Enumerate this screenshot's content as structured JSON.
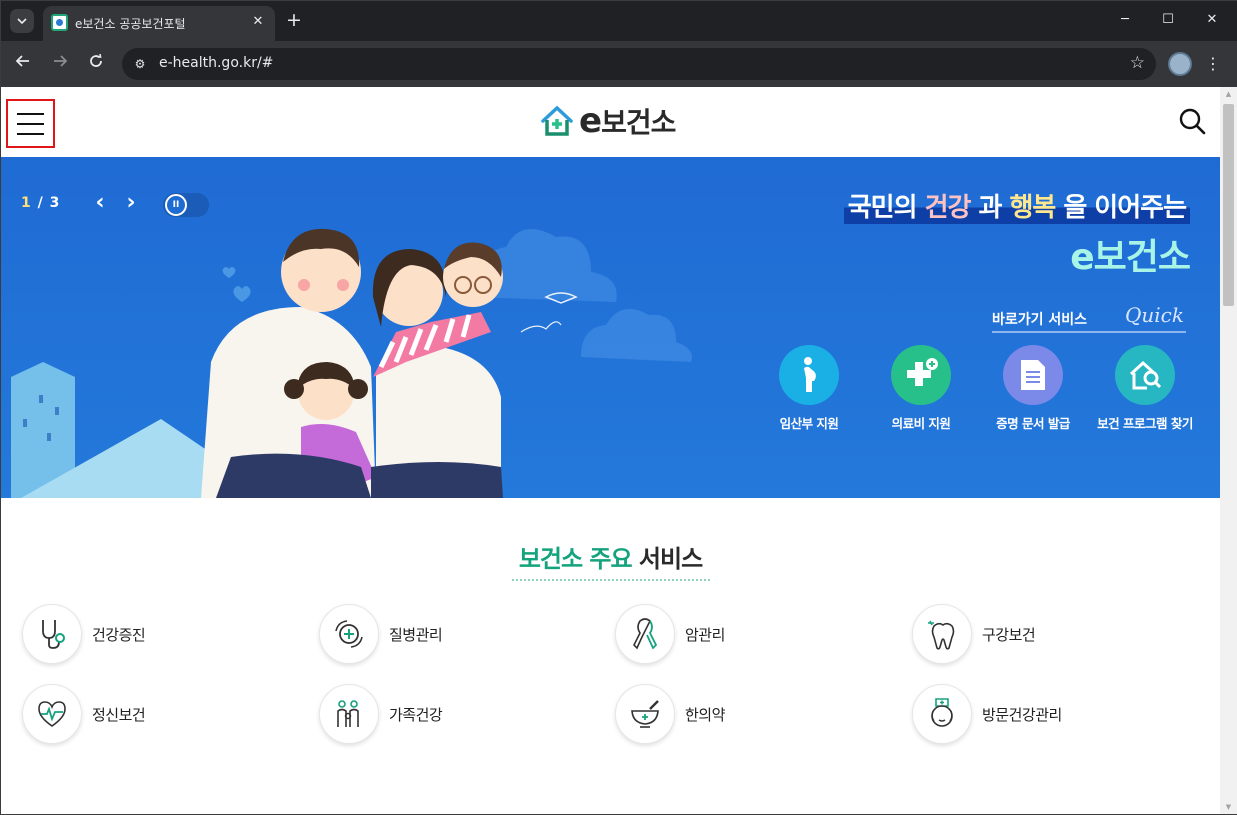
{
  "browser": {
    "tab_title": "e보건소 공공보건포털",
    "tab_close": "✕",
    "new_tab": "+",
    "url": "e-health.go.kr/#",
    "window_controls": {
      "minimize": "─",
      "maximize": "☐",
      "close": "✕"
    }
  },
  "header": {
    "logo_text": "보건소",
    "logo_e": "e"
  },
  "banner": {
    "slide_current": "1",
    "slide_separator": " / ",
    "slide_total": "3",
    "prev": "‹",
    "next": "›",
    "pause": "II",
    "headline": {
      "part1": "국민의 ",
      "word_health": "건강",
      "part2": " 과 ",
      "word_happiness": "행복",
      "part3": " 을 이어주는",
      "line2": "e보건소"
    },
    "quick": {
      "title": "바로가기 서비스",
      "title_en": "Quick",
      "items": [
        {
          "label": "임산부 지원",
          "icon": "pregnant-woman-icon",
          "color": "#1ab0e6"
        },
        {
          "label": "의료비 지원",
          "icon": "medical-plus-icon",
          "color": "#27c08a"
        },
        {
          "label": "증명 문서 발급",
          "icon": "document-icon",
          "color": "#7b89e8"
        },
        {
          "label": "보건 프로그램 찾기",
          "icon": "home-search-icon",
          "color": "#27b7c3"
        }
      ]
    }
  },
  "services": {
    "title_accent": "보건소 주요",
    "title_rest": " 서비스",
    "items": [
      {
        "label": "건강증진",
        "icon": "stethoscope-icon"
      },
      {
        "label": "질병관리",
        "icon": "disease-care-icon"
      },
      {
        "label": "암관리",
        "icon": "ribbon-icon"
      },
      {
        "label": "구강보건",
        "icon": "tooth-icon"
      },
      {
        "label": "정신보건",
        "icon": "heart-pulse-icon"
      },
      {
        "label": "가족건강",
        "icon": "family-icon"
      },
      {
        "label": "한의약",
        "icon": "mortar-icon"
      },
      {
        "label": "방문건강관리",
        "icon": "nurse-icon"
      }
    ]
  },
  "colors": {
    "accent_green": "#15a37e",
    "banner_blue": "#1f6bd4",
    "highlight_border": "#e0151a"
  }
}
